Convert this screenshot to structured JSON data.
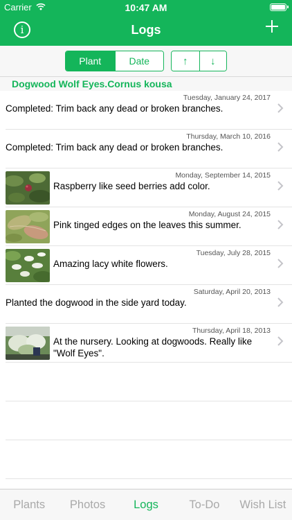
{
  "status": {
    "carrier": "Carrier",
    "time": "10:47 AM"
  },
  "nav": {
    "title": "Logs",
    "info_label": "i"
  },
  "sort_segment": {
    "options": [
      "Plant",
      "Date"
    ],
    "selected": "Plant"
  },
  "order_segment": {
    "options": [
      "↑",
      "↓"
    ]
  },
  "section": {
    "title": "Dogwood Wolf Eyes.Cornus kousa"
  },
  "logs": [
    {
      "date": "Tuesday, January 24, 2017",
      "text": "Completed: Trim back any dead or broken branches."
    },
    {
      "date": "Thursday, March 10, 2016",
      "text": "Completed: Trim back any dead or broken branches."
    },
    {
      "date": "Monday, September 14, 2015",
      "text": "Raspberry like seed berries add color.",
      "thumb": "berries-photo"
    },
    {
      "date": "Monday, August 24, 2015",
      "text": "Pink tinged edges on the leaves this summer.",
      "thumb": "leaves-photo"
    },
    {
      "date": "Tuesday, July 28, 2015",
      "text": "Amazing lacy white flowers.",
      "thumb": "flowers-photo"
    },
    {
      "date": "Saturday, April 20, 2013",
      "text": "Planted the dogwood in the side yard today."
    },
    {
      "date": "Thursday, April 18, 2013",
      "text": "At the nursery. Looking at dogwoods. Really like \"Wolf Eyes\".",
      "thumb": "nursery-photo"
    }
  ],
  "tabs": [
    {
      "label": "Plants",
      "active": false
    },
    {
      "label": "Photos",
      "active": false
    },
    {
      "label": "Logs",
      "active": true
    },
    {
      "label": "To-Do",
      "active": false
    },
    {
      "label": "Wish List",
      "active": false
    }
  ],
  "colors": {
    "accent": "#14b55a",
    "inactive_tab": "#a9a9a9"
  }
}
